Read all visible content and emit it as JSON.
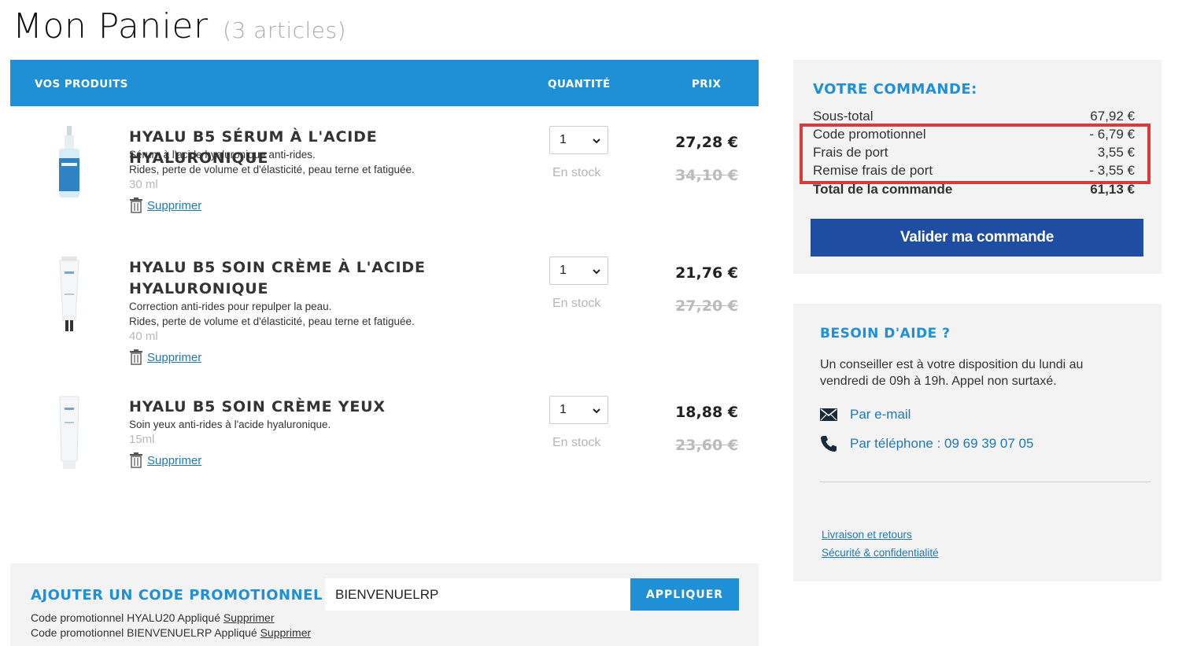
{
  "page": {
    "title": "Mon Panier",
    "count": "(3 articles)"
  },
  "table": {
    "col_products": "VOS PRODUITS",
    "col_quantity": "QUANTITÉ",
    "col_price": "PRIX"
  },
  "products": [
    {
      "title": "HYALU B5 SÉRUM À L'ACIDE HYALURONIQUE",
      "desc1": "Sérum à l'acide hyaluronique anti-rides.",
      "desc2": "Rides, perte de volume et d'élasticité, peau terne et fatiguée.",
      "size": "30 ml",
      "remove": "Supprimer",
      "qty": "1",
      "stock": "En stock",
      "price": "27,28 €",
      "old_price": "34,10 €"
    },
    {
      "title": "HYALU B5 SOIN CRÈME À L'ACIDE HYALURONIQUE",
      "desc1": "Correction anti-rides pour repulper la peau.",
      "desc2": "Rides, perte de volume et d'élasticité, peau terne et fatiguée.",
      "size": "40 ml",
      "remove": "Supprimer",
      "qty": "1",
      "stock": "En stock",
      "price": "21,76 €",
      "old_price": "27,20 €"
    },
    {
      "title": "HYALU B5 SOIN CRÈME YEUX",
      "desc1": "Soin yeux anti-rides à l'acide hyaluronique.",
      "size": "15ml",
      "remove": "Supprimer",
      "qty": "1",
      "stock": "En stock",
      "price": "18,88 €",
      "old_price": "23,60 €"
    }
  ],
  "promo": {
    "title": "AJOUTER UN CODE PROMOTIONNEL",
    "input_value": "BIENVENUELRP",
    "apply_label": "APPLIQUER",
    "applied": [
      {
        "text": "Code promotionnel HYALU20 Appliqué",
        "remove": "Supprimer"
      },
      {
        "text": "Code promotionnel BIENVENUELRP Appliqué",
        "remove": "Supprimer"
      }
    ]
  },
  "summary": {
    "title": "VOTRE COMMANDE:",
    "rows": [
      {
        "label": "Sous-total",
        "value": "67,92 €"
      },
      {
        "label": "Code promotionnel",
        "value": "- 6,79 €"
      },
      {
        "label": "Frais de port",
        "value": "3,55 €"
      },
      {
        "label": "Remise frais de port",
        "value": "- 3,55 €"
      },
      {
        "label": "Total de la commande",
        "value": "61,13 €"
      }
    ],
    "validate_label": "Valider ma commande"
  },
  "help": {
    "title": "BESOIN D'AIDE ?",
    "text": "Un conseiller est à votre disposition du lundi au vendredi de 09h à 19h. Appel non surtaxé.",
    "email_label": "Par e-mail",
    "phone_label": "Par téléphone : 09 69 39 07 05",
    "footer_links": [
      "Livraison et retours",
      "Sécurité & confidentialité"
    ]
  },
  "colors": {
    "accent_blue": "#1f8fd6",
    "button_dark_blue": "#1e4da1",
    "highlight_red": "#d93a3a",
    "panel_gray": "#f3f3f3"
  },
  "icons": {
    "remove": "trash-icon",
    "select": "chevron-down-icon",
    "email": "envelope-icon",
    "phone": "phone-icon"
  }
}
